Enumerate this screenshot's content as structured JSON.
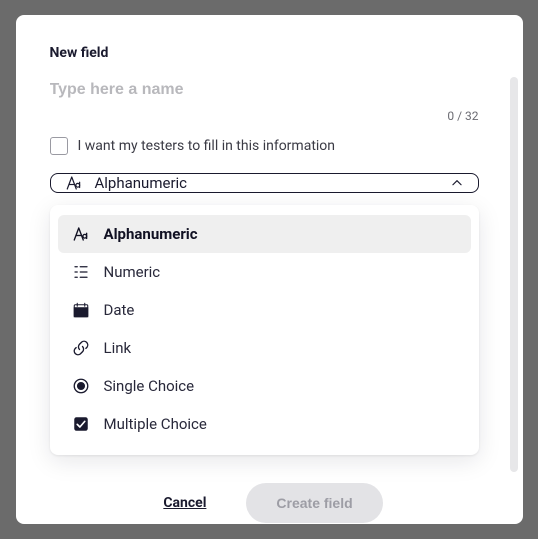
{
  "modal": {
    "title": "New field",
    "name_placeholder": "Type here a name",
    "counter": "0 / 32",
    "tester_checkbox_label": "I want my testers to fill in this information"
  },
  "select": {
    "current": "Alphanumeric",
    "options": [
      {
        "icon": "text-icon",
        "label": "Alphanumeric",
        "selected": true
      },
      {
        "icon": "numeric-icon",
        "label": "Numeric",
        "selected": false
      },
      {
        "icon": "date-icon",
        "label": "Date",
        "selected": false
      },
      {
        "icon": "link-icon",
        "label": "Link",
        "selected": false
      },
      {
        "icon": "single-choice-icon",
        "label": "Single Choice",
        "selected": false
      },
      {
        "icon": "multiple-choice-icon",
        "label": "Multiple Choice",
        "selected": false
      }
    ]
  },
  "footer": {
    "cancel": "Cancel",
    "create": "Create field"
  }
}
